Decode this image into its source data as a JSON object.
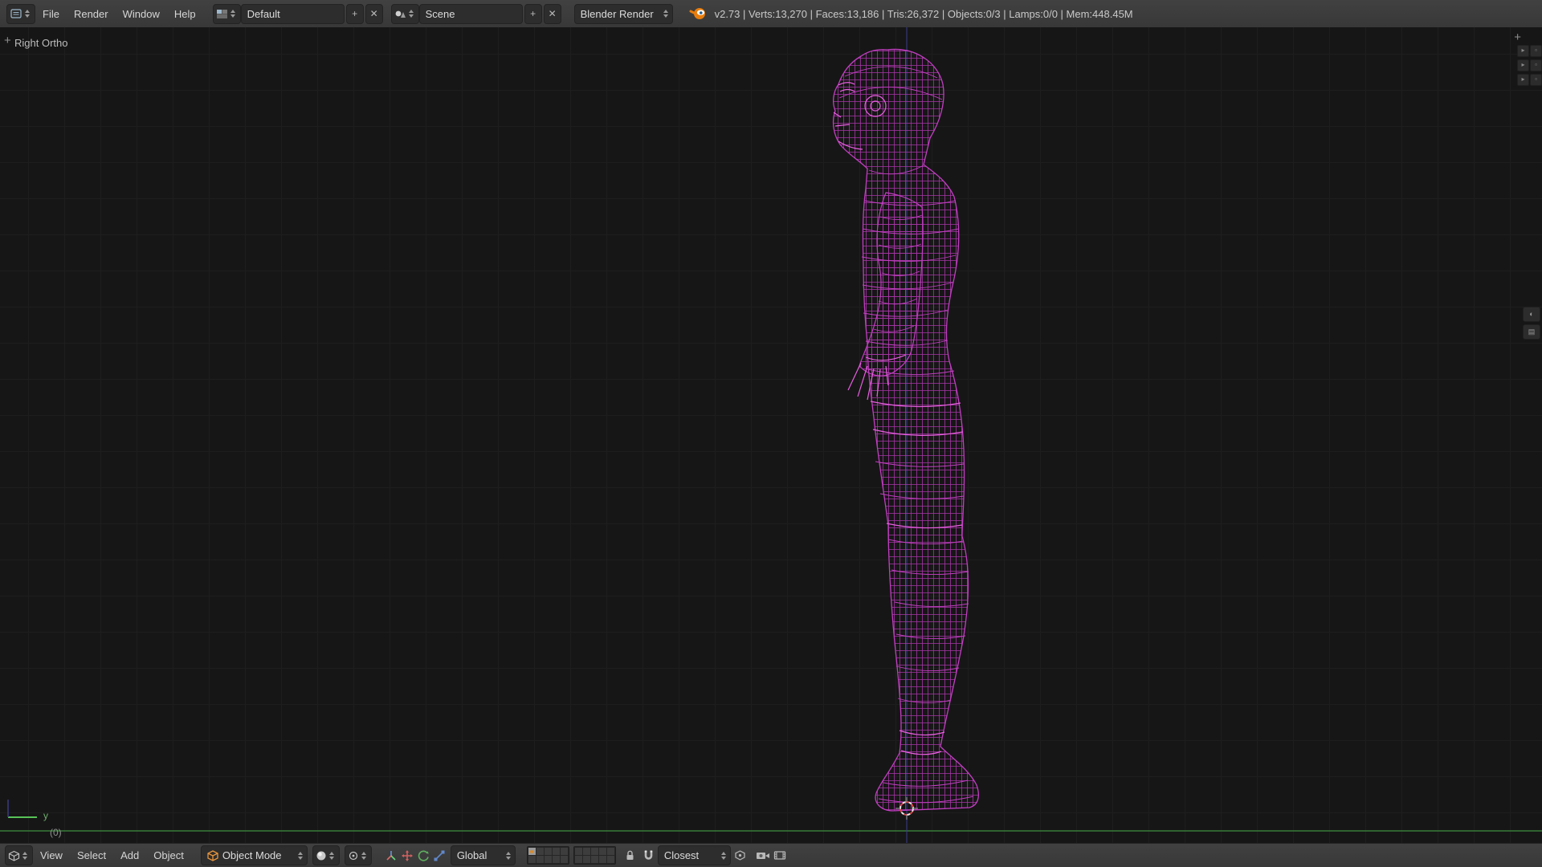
{
  "top_header": {
    "menus": [
      "File",
      "Render",
      "Window",
      "Help"
    ],
    "layout_selector": {
      "value": "Default"
    },
    "scene_selector": {
      "value": "Scene"
    },
    "engine_selector": {
      "value": "Blender Render"
    },
    "stats": "v2.73 | Verts:13,270 | Faces:13,186 | Tris:26,372 | Objects:0/3 | Lamps:0/0 | Mem:448.45M"
  },
  "viewport": {
    "view_label": "Right Ortho",
    "axis_label_y": "y",
    "frame_label": "(0)"
  },
  "bottom_header": {
    "menus": [
      "View",
      "Select",
      "Add",
      "Object"
    ],
    "mode_selector": {
      "value": "Object Mode"
    },
    "orientation_selector": {
      "value": "Global"
    },
    "snap_mode_selector": {
      "value": "Closest"
    }
  },
  "icons": {
    "plus": "+",
    "close": "✕"
  },
  "colors": {
    "wireframe": "#c23ec2",
    "wireframe_dim": "#a835a8",
    "wireframe_bright": "#ea5fe2",
    "axis_y_green": "#3f8f3f",
    "axis_z_blue": "#3c3c8c",
    "gizmo_green": "#57c357",
    "cursor_red": "#d84444",
    "mode_icon_orange": "#e8953c",
    "logo_orange": "#e87d0d"
  }
}
